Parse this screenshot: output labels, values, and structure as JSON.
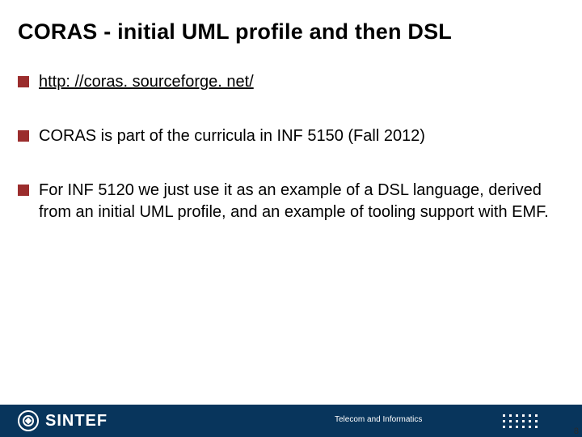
{
  "title": "CORAS  - initial UML profile and then DSL",
  "items": [
    {
      "text": "http: //coras. sourceforge. net/",
      "is_link": true
    },
    {
      "text": "CORAS is part of the curricula in INF 5150 (Fall 2012)",
      "is_link": false
    },
    {
      "text": "For INF 5120  we just use it as an example of a DSL language, derived from an initial UML profile, and an example of tooling support with EMF.",
      "is_link": false
    }
  ],
  "footer": {
    "logo": "SINTEF",
    "label": "Telecom and Informatics"
  },
  "page_number": "8",
  "colors": {
    "bullet": "#9b2d2d",
    "footer_bg": "#08355c"
  }
}
